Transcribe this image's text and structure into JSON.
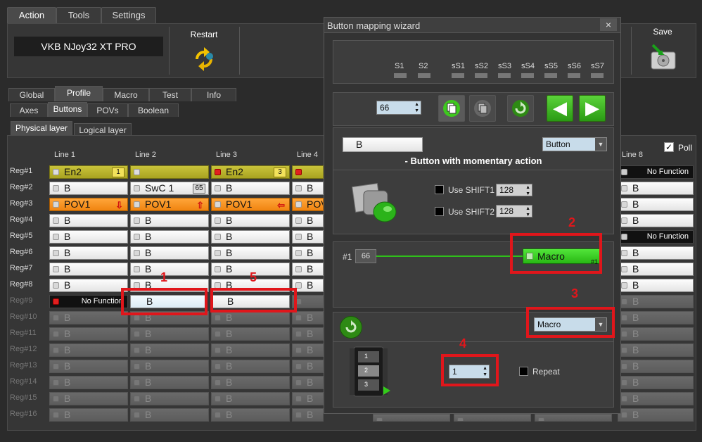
{
  "menu": {
    "action": "Action",
    "tools": "Tools",
    "settings": "Settings"
  },
  "device": {
    "name": "VKB NJoy32 XT PRO",
    "restart_label": "Restart",
    "save_label": "Save"
  },
  "main_tabs": [
    "Global",
    "Profile",
    "Macro",
    "Test",
    "Info"
  ],
  "sub_tabs": [
    "Axes",
    "Buttons",
    "POVs",
    "Boolean"
  ],
  "layer_tabs": [
    "Physical layer",
    "Logical layer"
  ],
  "poll_label": "Poll",
  "columns": [
    "Line 1",
    "Line 2",
    "Line 3",
    "Line 4",
    "Line 8"
  ],
  "regs": [
    "Reg#1",
    "Reg#2",
    "Reg#3",
    "Reg#4",
    "Reg#5",
    "Reg#6",
    "Reg#7",
    "Reg#8",
    "Reg#9",
    "Reg#10",
    "Reg#11",
    "Reg#12",
    "Reg#13",
    "Reg#14",
    "Reg#15",
    "Reg#16"
  ],
  "grid": {
    "en2": "En2",
    "b": "B",
    "swc": "SwC  1",
    "pov": "POV1",
    "pov_short": "POV",
    "no_function": "No Function",
    "badge_1": "1",
    "badge_65": "65",
    "badge_3": "3"
  },
  "wizard": {
    "title": "Button mapping wizard",
    "close": "×",
    "shift_labels": [
      "S1",
      "S2",
      "sS1",
      "sS2",
      "sS3",
      "sS4",
      "sS5",
      "sS6",
      "sS7"
    ],
    "button_number": "66",
    "button_name": "B",
    "type_select": "Button",
    "description": "- Button with momentary action",
    "shift1_label": "Use SHIFT1",
    "shift2_label": "Use SHIFT2",
    "shift1_value": "128",
    "shift2_value": "128",
    "map_index": "#1",
    "map_number": "66",
    "macro_block_label": "Macro",
    "macro_block_index": "#1",
    "function_select": "Macro",
    "macro_number": "1",
    "repeat_label": "Repeat",
    "film_frames": [
      "1",
      "2",
      "3"
    ]
  },
  "annotations": [
    "1",
    "2",
    "3",
    "4",
    "5"
  ],
  "colors": {
    "highlight": "#e0161b",
    "macro_green": "#33cc1a",
    "yellow_cell": "#bdb62e",
    "orange_cell": "#f7951f"
  }
}
